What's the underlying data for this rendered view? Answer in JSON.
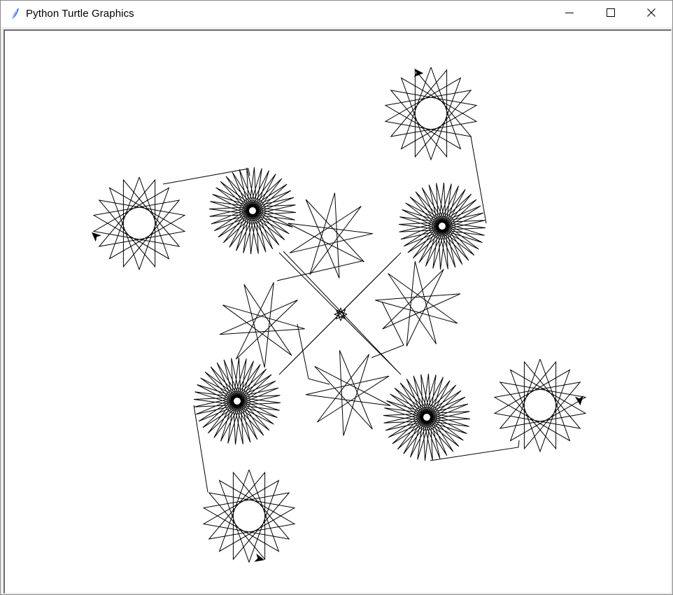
{
  "window": {
    "title": "Python Turtle Graphics",
    "icons": {
      "app": "feather-icon",
      "minimize": "minimize-icon",
      "maximize": "maximize-icon",
      "close": "close-icon"
    }
  },
  "colors": {
    "pen": "#000000",
    "canvas_background": "#ffffff",
    "titlebar_background": "#ffffff",
    "window_border": "#8a8a8a",
    "app_icon": "#3a6fd8"
  }
}
